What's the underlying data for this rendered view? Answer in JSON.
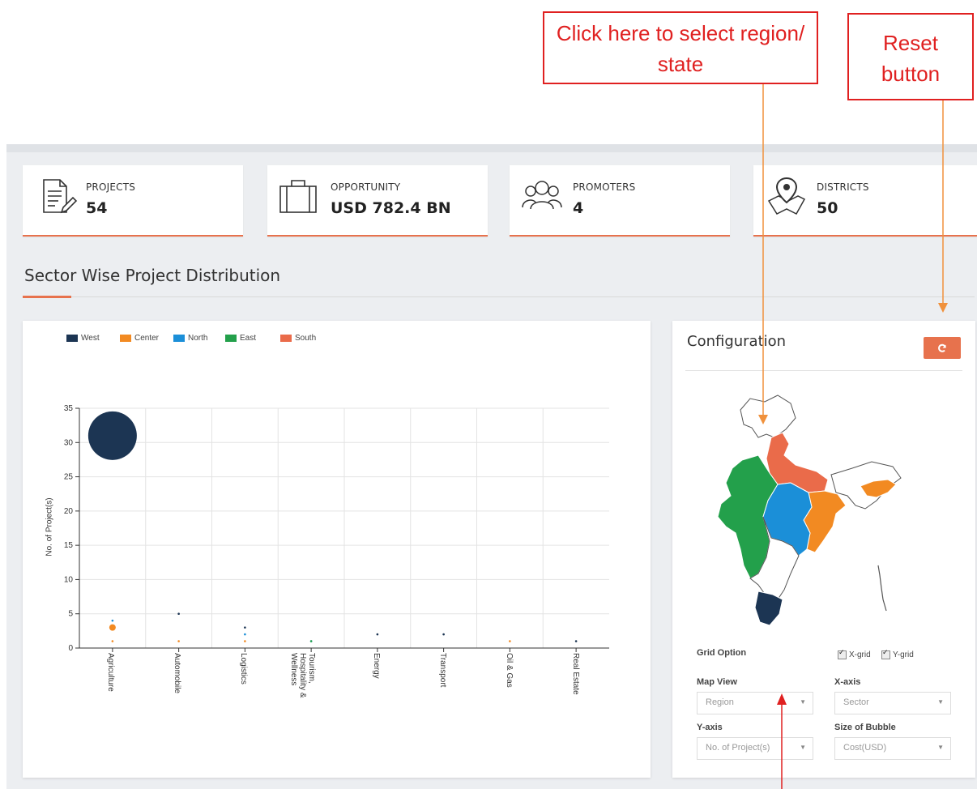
{
  "annotations": {
    "select_region": "Click here to select region/ state",
    "reset": "Reset button"
  },
  "stats": [
    {
      "label": "PROJECTS",
      "value": "54",
      "icon": "document-pen-icon"
    },
    {
      "label": "OPPORTUNITY",
      "value": "USD 782.4 BN",
      "icon": "briefcase-icon"
    },
    {
      "label": "PROMOTERS",
      "value": "4",
      "icon": "people-group-icon"
    },
    {
      "label": "DISTRICTS",
      "value": "50",
      "icon": "map-pin-icon"
    }
  ],
  "section_title": "Sector Wise Project Distribution",
  "config": {
    "title": "Configuration",
    "reset_icon": "refresh-icon",
    "grid_option_label": "Grid Option",
    "xgrid_label": "X-grid",
    "ygrid_label": "Y-grid",
    "map_view_label": "Map View",
    "map_view_value": "Region",
    "xaxis_label": "X-axis",
    "xaxis_value": "Sector",
    "yaxis_label": "Y-axis",
    "yaxis_value": "No. of Project(s)",
    "bubble_label": "Size of Bubble",
    "bubble_value": "Cost(USD)"
  },
  "colors": {
    "accent": "#e7724d",
    "callout": "#e02020",
    "arrow": "#f0913c"
  },
  "chart_data": {
    "type": "scatter",
    "title": "",
    "xlabel": "",
    "ylabel": "No. of Project(s)",
    "ylim": [
      0,
      35
    ],
    "yticks": [
      0,
      5,
      10,
      15,
      20,
      25,
      30,
      35
    ],
    "categories": [
      "Agriculture",
      "Automobile",
      "Logistics",
      "Tourism, Hospitality & Wellness",
      "Energy",
      "Transport",
      "Oil & Gas",
      "Real Estate"
    ],
    "grid": "x and y",
    "legend_position": "top-left",
    "series": [
      {
        "name": "West",
        "color": "#1c3553",
        "points": [
          {
            "x": "Agriculture",
            "y": 31,
            "size": "large"
          },
          {
            "x": "Automobile",
            "y": 5
          },
          {
            "x": "Logistics",
            "y": 3
          },
          {
            "x": "Energy",
            "y": 2
          },
          {
            "x": "Transport",
            "y": 2
          },
          {
            "x": "Real Estate",
            "y": 1
          }
        ]
      },
      {
        "name": "Center",
        "color": "#f28a22",
        "points": [
          {
            "x": "Agriculture",
            "y": 3,
            "size": "medium"
          },
          {
            "x": "Agriculture",
            "y": 1
          },
          {
            "x": "Automobile",
            "y": 1
          },
          {
            "x": "Logistics",
            "y": 1
          },
          {
            "x": "Oil & Gas",
            "y": 1
          }
        ]
      },
      {
        "name": "North",
        "color": "#1b8fd8",
        "points": [
          {
            "x": "Agriculture",
            "y": 4
          },
          {
            "x": "Logistics",
            "y": 2
          },
          {
            "x": "Tourism, Hospitality & Wellness",
            "y": 1
          }
        ]
      },
      {
        "name": "East",
        "color": "#23a04b",
        "points": [
          {
            "x": "Tourism, Hospitality & Wellness",
            "y": 1
          }
        ]
      },
      {
        "name": "South",
        "color": "#ea6b4a",
        "points": []
      }
    ]
  }
}
